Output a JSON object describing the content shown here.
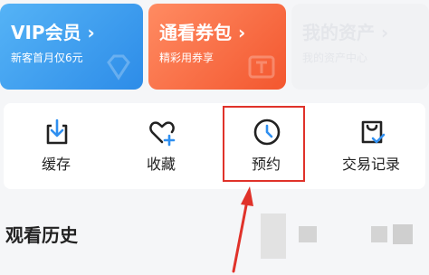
{
  "cards": [
    {
      "title": "VIP会员 ›",
      "subtitle": "新客首月仅6元"
    },
    {
      "title": "通看券包 ›",
      "subtitle": "精彩用券享"
    },
    {
      "title": "我的资产 ›",
      "subtitle": "我的资产中心"
    }
  ],
  "functions": [
    {
      "label": "缓存",
      "icon": "download-box-icon"
    },
    {
      "label": "收藏",
      "icon": "heart-plus-icon"
    },
    {
      "label": "预约",
      "icon": "clock-icon"
    },
    {
      "label": "交易记录",
      "icon": "bag-check-icon"
    }
  ],
  "history": {
    "title": "观看历史"
  },
  "colors": {
    "highlight": "#e0322a",
    "accent_check": "#2f8ff0",
    "vip": "#3a9bf0",
    "pass": "#f66a40"
  }
}
